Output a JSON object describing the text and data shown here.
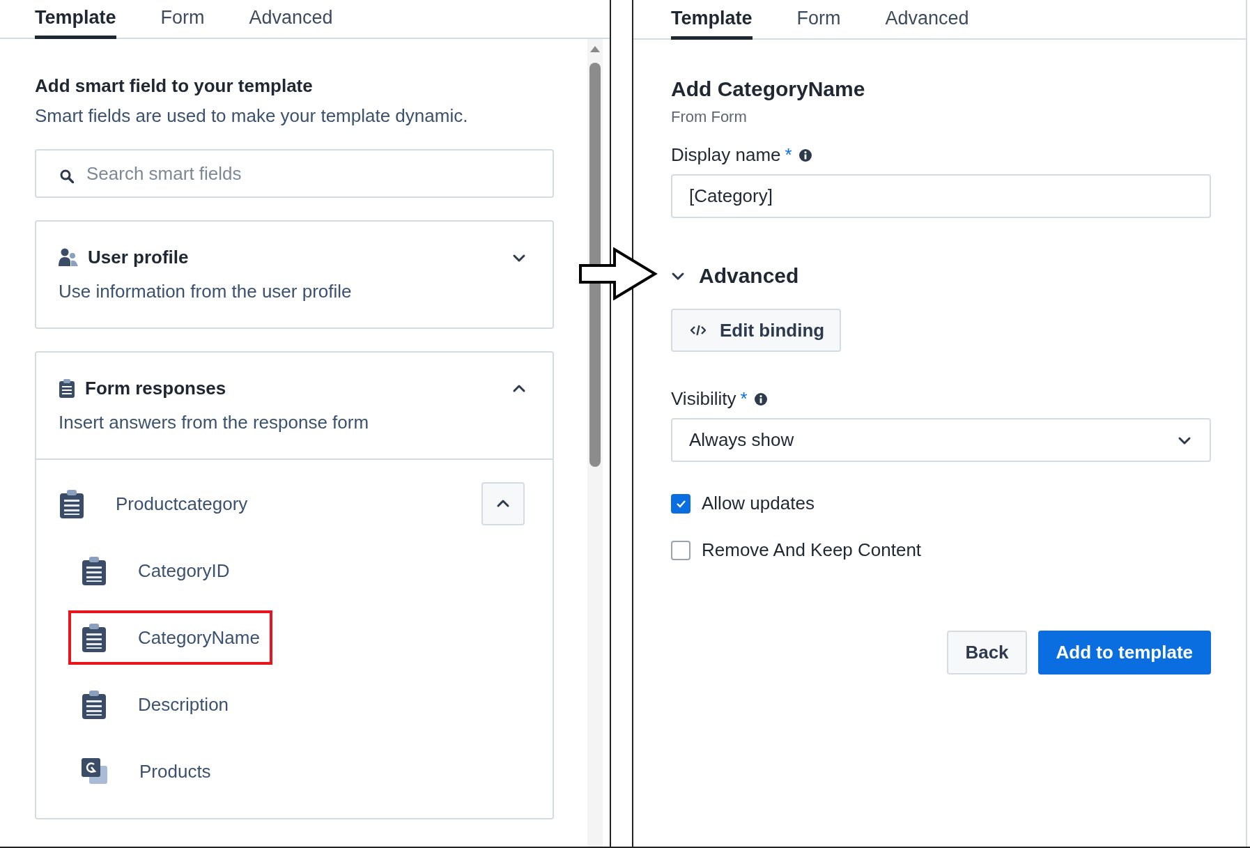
{
  "left_panel": {
    "tabs": [
      {
        "label": "Template",
        "selected": true
      },
      {
        "label": "Form",
        "selected": false
      },
      {
        "label": "Advanced",
        "selected": false
      }
    ],
    "heading": "Add smart field to your template",
    "description": "Smart fields are used to make your template dynamic.",
    "search": {
      "placeholder": "Search smart fields"
    },
    "sections": [
      {
        "kind": "user",
        "title": "User profile",
        "description": "Use information from the user profile",
        "expanded": false
      },
      {
        "kind": "form",
        "title": "Form responses",
        "description": "Insert answers from the response form",
        "expanded": true,
        "items": [
          {
            "kind": "field",
            "label": "Productcategory",
            "expanded": true,
            "highlighted": false,
            "children": [
              {
                "kind": "field",
                "label": "CategoryID",
                "highlighted": false
              },
              {
                "kind": "field",
                "label": "CategoryName",
                "highlighted": true
              },
              {
                "kind": "field",
                "label": "Description",
                "highlighted": false
              },
              {
                "kind": "collection",
                "label": "Products",
                "highlighted": false
              }
            ]
          }
        ]
      }
    ]
  },
  "right_panel": {
    "tabs": [
      {
        "label": "Template",
        "selected": true
      },
      {
        "label": "Form",
        "selected": false
      },
      {
        "label": "Advanced",
        "selected": false
      }
    ],
    "title": "Add CategoryName",
    "subtitle": "From Form",
    "display_name": {
      "label": "Display name",
      "required": "*",
      "value": "[Category]"
    },
    "advanced": {
      "label": "Advanced",
      "expanded": true,
      "button": "Edit binding"
    },
    "visibility": {
      "label": "Visibility",
      "required": "*",
      "value": "Always show"
    },
    "checkboxes": [
      {
        "label": "Allow updates",
        "checked": true
      },
      {
        "label": "Remove And Keep Content",
        "checked": false
      }
    ],
    "buttons": [
      {
        "kind": "secondary",
        "label": "Back"
      },
      {
        "kind": "primary",
        "label": "Add to template"
      }
    ]
  }
}
